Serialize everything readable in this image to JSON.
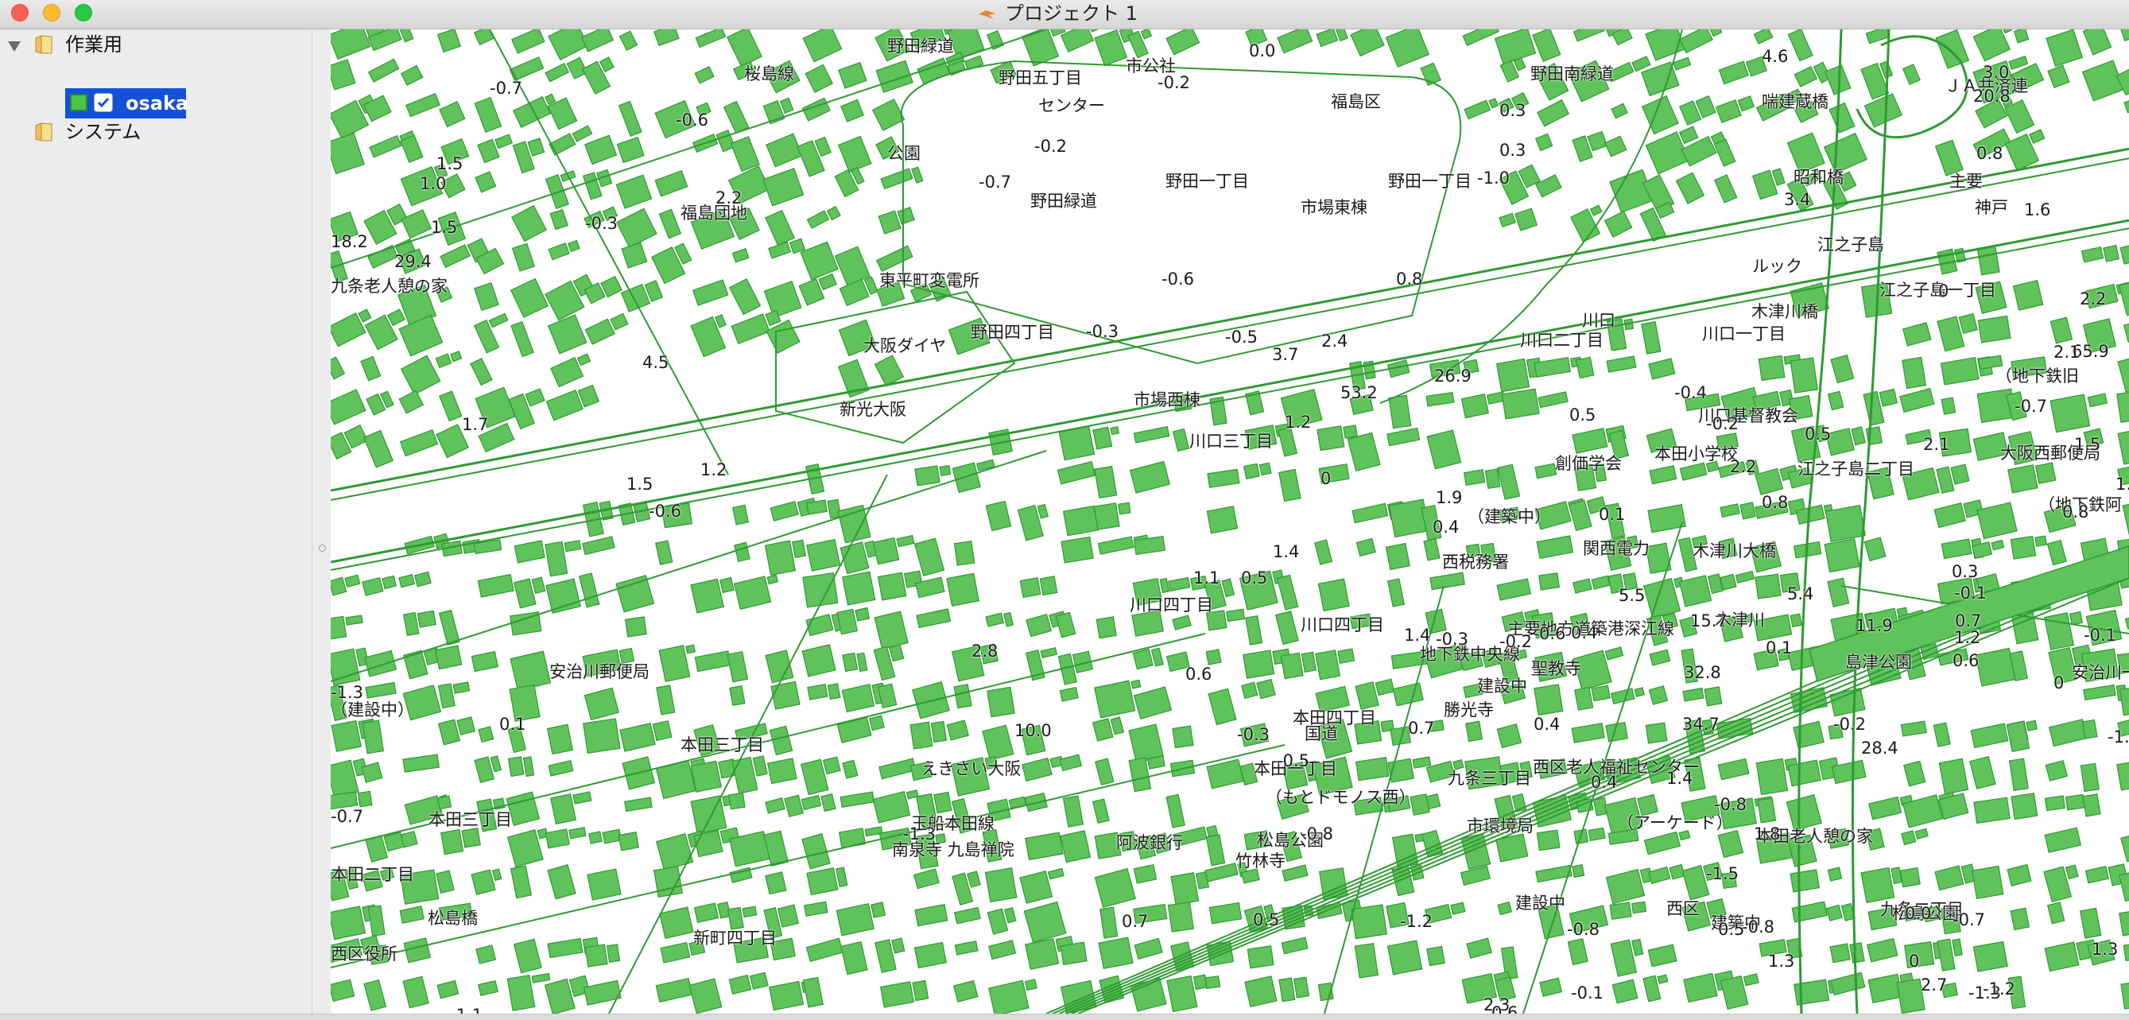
{
  "window": {
    "title": "プロジェクト 1"
  },
  "layer_tree": {
    "groups": [
      {
        "label": "作業用",
        "expanded": true,
        "layers": [
          {
            "label": "osaka",
            "checked": true,
            "selected": true,
            "color": "#4cc44a"
          }
        ]
      },
      {
        "label": "システム",
        "expanded": false,
        "layers": []
      }
    ]
  },
  "map": {
    "fill_color": "#5fc25b",
    "line_color": "#2f9a32",
    "place_labels": [
      "野田緑道",
      "桜島線",
      "野田五丁目",
      "センター",
      "市公社",
      "福島区",
      "野田南緑道",
      "喘建蔵橋",
      "ＪＡ共済連",
      "公園",
      "野田一丁目",
      "野田一丁目",
      "市場東棟",
      "野田緑道",
      "昭和橋",
      "福島団地",
      "主要",
      "神戸",
      "江之子島",
      "東平町変電所",
      "ルック",
      "江之子島一丁目",
      "九条老人憩の家",
      "木津川橋",
      "野田四丁目",
      "大阪ダイヤ",
      "川口二丁目",
      "川口",
      "川口一丁目",
      "（地下鉄旧",
      "新光大阪",
      "市場西棟",
      "川口基督教会",
      "大阪西郵便局",
      "川口三丁目",
      "創価学会",
      "本田小学校",
      "江之子島二丁目",
      "（建築中）",
      "（地下鉄阿",
      "西税務署",
      "関西電力",
      "木津川大橋",
      "川口四丁目",
      "川口四丁目",
      "主要地方道築港深江線",
      "木津川",
      "建設中",
      "地下鉄中央線",
      "島津公園",
      "安治川一丁目",
      "安治川郵便局",
      "（建設中）",
      "聖教寺",
      "国道",
      "勝光寺",
      "本田四丁目",
      "本田三丁目",
      "えきさい大阪",
      "本田一丁目",
      "九条三丁目",
      "西区老人福祉センター",
      "本田三丁目",
      "玉船本田線",
      "（もとドモノス西）",
      "南泉寺 九島禅院",
      "阿波銀行",
      "市環境局",
      "（アーケード）",
      "本田老人憩の家",
      "本田二丁目",
      "竹林寺",
      "松島公園",
      "建設中",
      "西区",
      "九条二丁目",
      "松島橋",
      "新町四丁目",
      "建築中",
      "松島公園",
      "西区役所"
    ],
    "values": [
      "-0.7",
      "0.0",
      "-0.2",
      "4.6",
      "3.0",
      "20.8",
      "-0.6",
      "-0.2",
      "0.3",
      "1.5",
      "1.0",
      "-0.7",
      "0.3",
      "0.8",
      "2.2",
      "-1.0",
      "3.4",
      "1.5",
      "-0.3",
      "1.6",
      "18.2",
      "29.4",
      "-0.6",
      "0.8",
      "0",
      "2.2",
      "-0.3",
      "-0.5",
      "2.4",
      "26.9",
      "65.9",
      "2.1",
      "3.7",
      "4.5",
      "-0.7",
      "1.7",
      "53.2",
      "-0.4",
      "1.5",
      "1.2",
      "1.2",
      "0.5",
      "-0.2",
      "0.5",
      "2.1",
      "1.5",
      "0.8",
      "2.2",
      "0.1",
      "1.9",
      "0.8",
      "-0.6",
      "1.4",
      "0",
      "1.9",
      "0.3",
      "0.4",
      "1.1",
      "0.5",
      "-0.1",
      "5.4",
      "0.7",
      "5.5",
      "15.7",
      "1.4",
      "1.2",
      "0.1",
      "11.9",
      "0.6",
      "0.6",
      "0.6",
      "0",
      "-0.1",
      "0.4",
      "-0.2",
      "-0.3",
      "2.8",
      "32.8",
      "0.1",
      "-1.3",
      "10.0",
      "0.7",
      "0.4",
      "28.4",
      "-0.2",
      "34.7",
      "-0.5",
      "-0.3",
      "1.4",
      "0.4",
      "-1.0",
      "-0.8",
      "1.8",
      "-1.3",
      "-0.8",
      "0.0",
      "0.7",
      "-1.5",
      "-0.8",
      "0.5",
      "0.5",
      "-1.2",
      "-0.8",
      "-0.7",
      "0",
      "2.7",
      "-1.1",
      "-0.1",
      "2.3",
      "0.6",
      "-1.3",
      "-1.2",
      "-0.7",
      "1.3",
      "1.3",
      "1.7"
    ]
  }
}
